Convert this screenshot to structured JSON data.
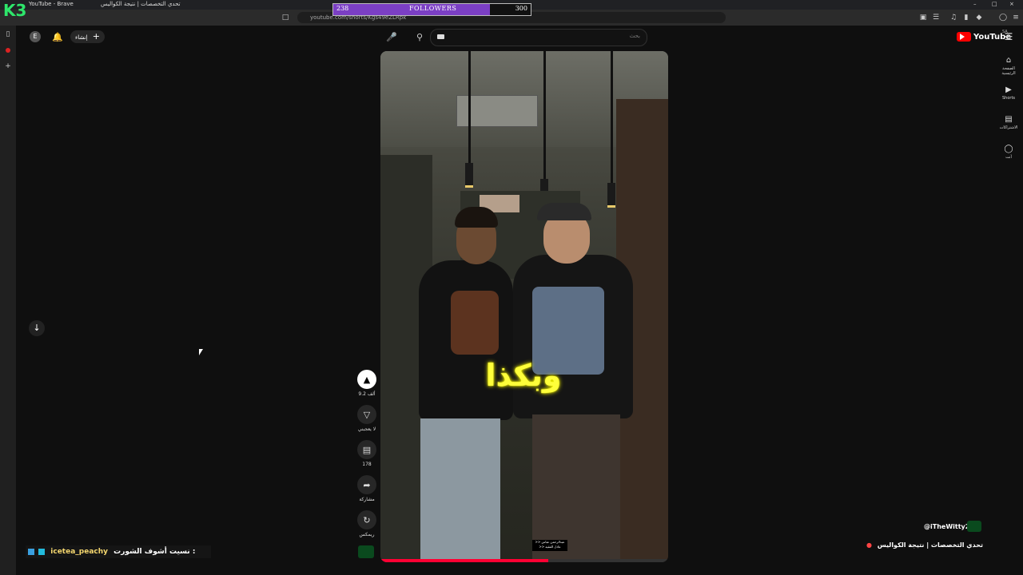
{
  "browser": {
    "tab_title": "YouTube - Brave",
    "tab_title_2": "تحدي التخصصات | نتيجة الكواليس",
    "url": "youtube.com/shorts/Kgs49eZLRpk",
    "window_controls": [
      "–",
      "□",
      "×"
    ]
  },
  "overlay": {
    "logo": "K3",
    "followers_label": "FOLLOWERS",
    "followers_current": "238",
    "followers_goal": "300",
    "followers_fraction": 0.793,
    "fill_color": "#7b3fc4"
  },
  "header": {
    "logo_text": "YouTube",
    "logo_sup": "SA",
    "create_label": "إنشاء",
    "search_placeholder": "بحث",
    "avatar_letter": "E"
  },
  "right_nav": [
    {
      "label": "الصفحة الرئيسية",
      "icon": "home-icon"
    },
    {
      "label": "Shorts",
      "icon": "shorts-icon"
    },
    {
      "label": "الاشتراكات",
      "icon": "subscriptions-icon"
    },
    {
      "label": "أنت",
      "icon": "you-icon"
    }
  ],
  "video": {
    "caption": "وبكذا",
    "credit_line1": ">> عبدالرحمن عباس",
    "credit_line2": ">> عادل الفقيه"
  },
  "actions": {
    "like_count": "9.2 ألف",
    "dislike_label": "لا يعجبني",
    "comments_count": "178",
    "share_label": "مشاركة",
    "remix_label": "ريمكس"
  },
  "chat": {
    "user": "icetea_peachy",
    "message": "نسيت أشوف الشورت :"
  },
  "stream_title": {
    "text": "تحدي التخصصات | نتيجة الكواليس",
    "handle": "@iTheWitty21"
  }
}
